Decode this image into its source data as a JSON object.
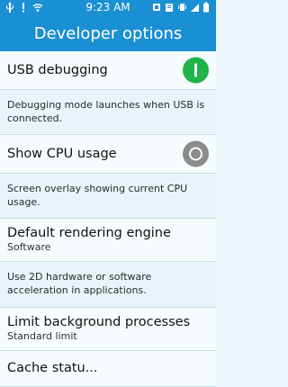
{
  "status_bar": {
    "time": "9:23 AM",
    "left_icons": [
      "usb-icon",
      "notification-icon",
      "wifi-icon"
    ],
    "right_icons": [
      "silent-icon",
      "alarm-icon",
      "vibrate-icon",
      "signal-icon",
      "battery-icon"
    ]
  },
  "header": {
    "title": "Developer options"
  },
  "items": [
    {
      "title": "USB debugging",
      "toggle": "on"
    },
    {
      "desc": "Debugging mode launches when USB is connected."
    },
    {
      "title": "Show CPU usage",
      "toggle": "off"
    },
    {
      "desc": "Screen overlay showing current CPU usage."
    },
    {
      "title": "Default rendering engine",
      "subtitle": "Software"
    },
    {
      "desc": "Use 2D hardware or software acceleration in applications."
    },
    {
      "title": "Limit background processes",
      "subtitle": "Standard limit"
    },
    {
      "title": "Cache statu..."
    }
  ],
  "colors": {
    "accent": "#1b8fd3",
    "toggle_on": "#1fb34a",
    "toggle_off": "#8b8b8b"
  }
}
